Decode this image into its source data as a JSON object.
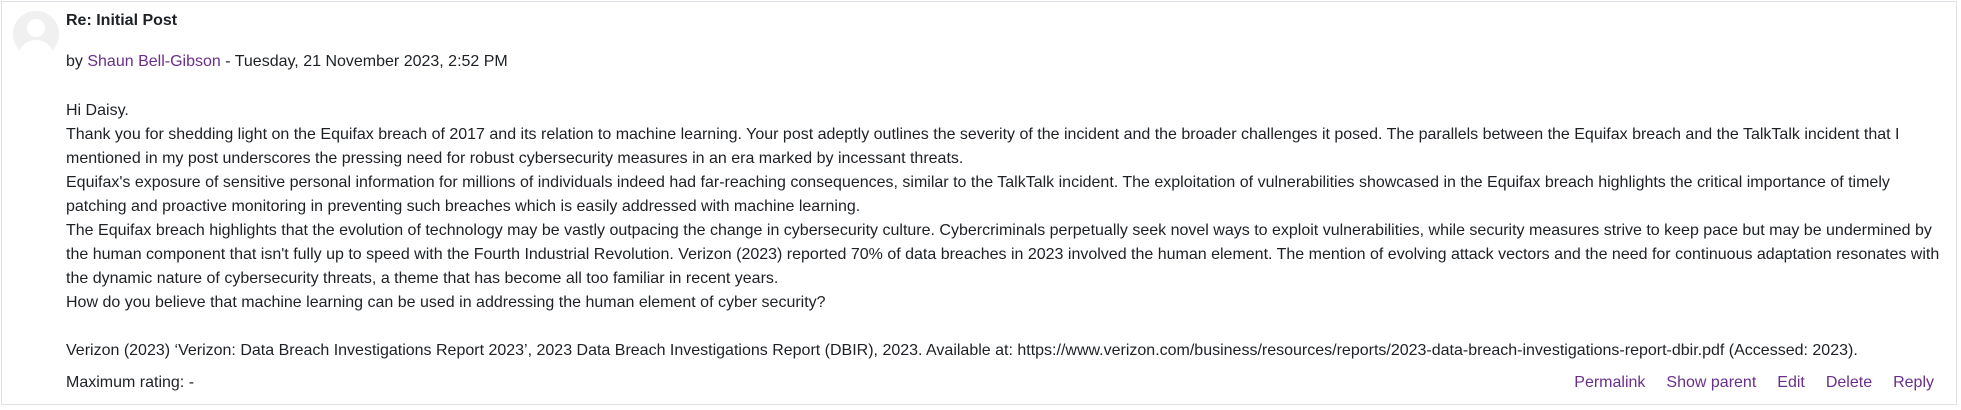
{
  "post": {
    "subject": "Re: Initial Post",
    "by_prefix": "by",
    "author": "Shaun Bell-Gibson",
    "date_separator": " - ",
    "date": "Tuesday, 21 November 2023, 2:52 PM",
    "paragraphs": [
      "Hi Daisy.",
      "Thank you for shedding light on the Equifax breach of 2017 and its relation to machine learning. Your post adeptly outlines the severity of the incident and the broader challenges it posed. The parallels between the Equifax breach and the TalkTalk incident that I mentioned in my post underscores the pressing need for robust cybersecurity measures in an era marked by incessant threats.",
      "Equifax's exposure of sensitive personal information for millions of individuals indeed had far-reaching consequences, similar to the TalkTalk incident. The exploitation of vulnerabilities showcased in the Equifax breach highlights the critical importance of timely patching and proactive monitoring in preventing such breaches which is easily addressed with machine learning.",
      "The Equifax breach highlights that the evolution of technology may be vastly outpacing the change in cybersecurity culture. Cybercriminals perpetually seek novel ways to exploit vulnerabilities, while security measures strive to keep pace but may be undermined by the human component that isn't fully up to speed with the Fourth Industrial Revolution. Verizon (2023) reported 70% of data breaches in 2023 involved the human element. The mention of evolving attack vectors and the need for continuous adaptation resonates with the dynamic nature of cybersecurity threats, a theme that has become all too familiar in recent years.",
      "How do you believe that machine learning can be used in addressing the human element of cyber security?"
    ],
    "reference": "Verizon (2023) ‘Verizon: Data Breach Investigations Report 2023’, 2023 Data Breach Investigations Report (DBIR), 2023. Available at: https://www.verizon.com/business/resources/reports/2023-data-breach-investigations-report-dbir.pdf (Accessed: 2023).",
    "rating_text": "Maximum rating: -",
    "commands": {
      "permalink": "Permalink",
      "show_parent": "Show parent",
      "edit": "Edit",
      "delete": "Delete",
      "reply": "Reply"
    }
  },
  "colors": {
    "link": "#6a2f8a",
    "text": "#1d2125",
    "border": "#dee2e6",
    "avatar_bg": "#f0f0f0",
    "avatar_fg": "#ffffff"
  },
  "icons": {
    "avatar": "default-user-avatar-icon"
  }
}
